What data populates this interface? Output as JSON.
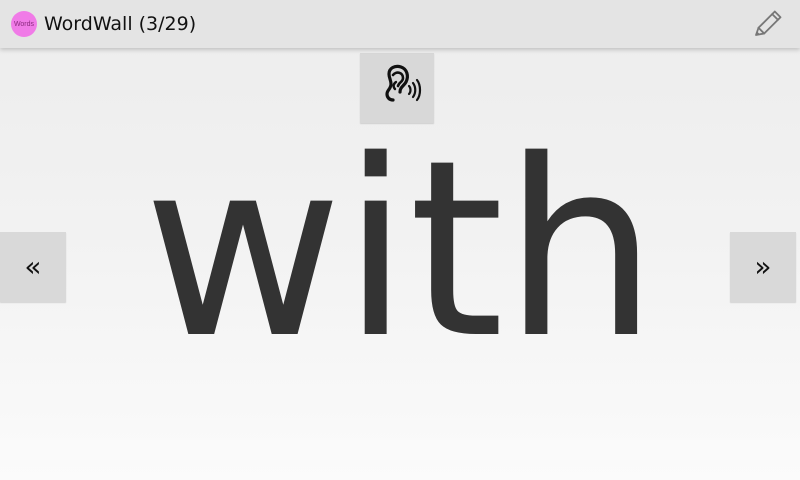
{
  "header": {
    "app_icon_text": "Words",
    "title": "WordWall (3/29)",
    "edit_icon": "pencil-icon"
  },
  "main": {
    "sound_icon": "ear-sound-icon",
    "word": "with",
    "previous_label": "«",
    "next_label": "»"
  }
}
